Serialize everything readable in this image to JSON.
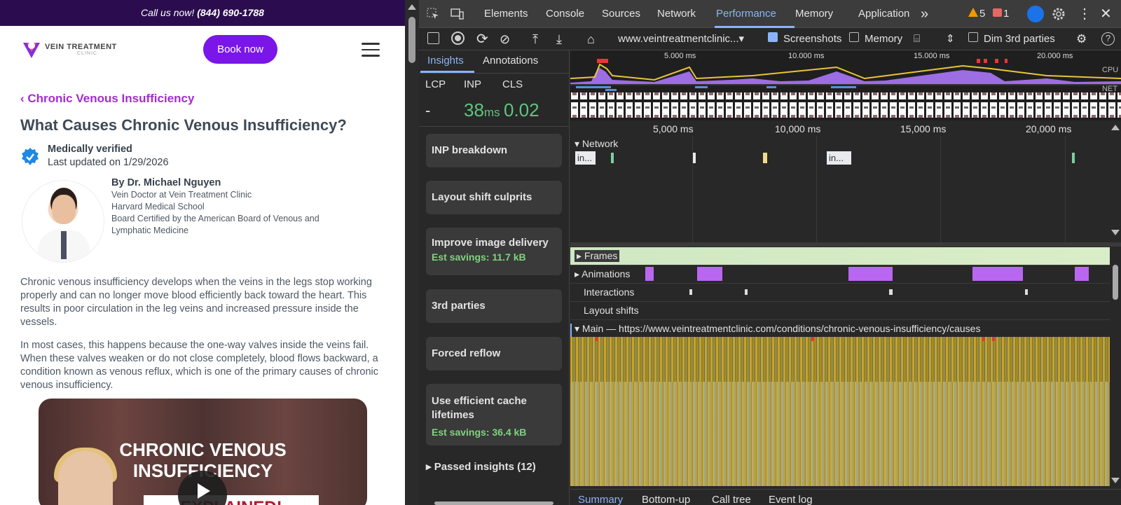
{
  "page": {
    "callbar_prefix": "Call us now!",
    "callbar_phone": "(844) 690-1788",
    "logo_text": "VEIN TREATMENT",
    "logo_sub": "CLINIC",
    "book_label": "Book now",
    "breadcrumb": "Chronic Venous Insufficiency",
    "title": "What Causes Chronic Venous Insufficiency?",
    "verified": "Medically verified",
    "updated": "Last updated on 1/29/2026",
    "author": "By Dr. Michael Nguyen",
    "credentials": [
      "Vein Doctor at Vein Treatment Clinic",
      "Harvard Medical School",
      "Board Certified by the American Board of Venous and",
      "Lymphatic Medicine"
    ],
    "paragraphs": [
      "Chronic venous insufficiency develops when the veins in the legs stop working properly and can no longer move blood efficiently back toward the heart. This results in poor circulation in the leg veins and increased pressure inside the vessels.",
      "In most cases, this happens because the one-way valves inside the veins fail. When these valves weaken or do not close completely, blood flows backward, a condition known as venous reflux, which is one of the primary causes of chronic venous insufficiency."
    ],
    "video_line1": "CHRONIC VENOUS",
    "video_line2": "INSUFFICIENCY",
    "video_banner": "EXPLAINED!"
  },
  "devtools": {
    "tabs": [
      "Elements",
      "Console",
      "Sources",
      "Network",
      "Performance",
      "Memory",
      "Application"
    ],
    "selected_tab": "Performance",
    "more": "»",
    "warnings": "5",
    "errors": "1",
    "url": "www.veintreatmentclinic...▾",
    "screenshots_label": "Screenshots",
    "memory_label": "Memory",
    "dim_label": "Dim 3rd parties",
    "side_tabs": [
      "Insights",
      "Annotations"
    ],
    "metrics": {
      "lcp_label": "LCP",
      "inp_label": "INP",
      "cls_label": "CLS",
      "lcp_value": "-",
      "inp_value": "38",
      "inp_unit": "ms",
      "cls_value": "0.02"
    },
    "insights": [
      {
        "label": "INP breakdown",
        "savings": ""
      },
      {
        "label": "Layout shift culprits",
        "savings": ""
      },
      {
        "label": "Improve image delivery",
        "savings": "Est savings: 11.7 kB"
      },
      {
        "label": "3rd parties",
        "savings": ""
      },
      {
        "label": "Forced reflow",
        "savings": ""
      },
      {
        "label": "Use efficient cache lifetimes",
        "savings": "Est savings: 36.4 kB"
      }
    ],
    "passed": "Passed insights (12)",
    "overview_ticks": [
      "5.000 ms",
      "10.000 ms",
      "15.000 ms",
      "20.000 ms"
    ],
    "cpu_label": "CPU",
    "net_label": "NET",
    "ruler_ticks": [
      "5,000 ms",
      "10,000 ms",
      "15,000 ms",
      "20,000 ms"
    ],
    "network_label": "Network",
    "net_bar1": "in...",
    "net_bar2": "in...",
    "tracks": [
      "Frames",
      "Animations",
      "Interactions",
      "Layout shifts"
    ],
    "main_label": "Main — https://www.veintreatmentclinic.com/conditions/chronic-venous-insufficiency/causes",
    "bottom_tabs": [
      "Summary",
      "Bottom-up",
      "Call tree",
      "Event log"
    ]
  }
}
